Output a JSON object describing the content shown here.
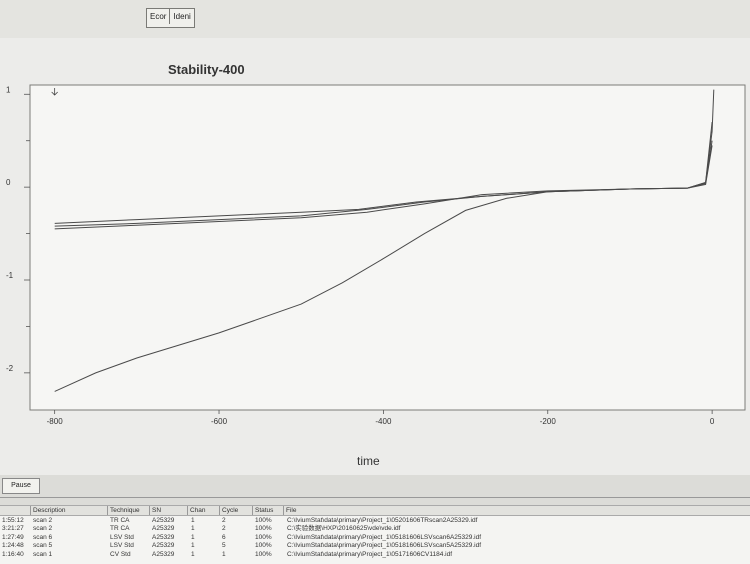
{
  "toolbar": {
    "buttons": [
      "Ecor",
      "Ideni"
    ]
  },
  "chart_data": {
    "type": "line",
    "title": "Stability-400",
    "xlabel": "time",
    "ylabel": "",
    "xlim": [
      -830,
      40
    ],
    "ylim": [
      -2.4,
      1.1
    ],
    "x_ticks": [
      "-800",
      "-600",
      "-400",
      "-200",
      "0"
    ],
    "y_ticks": [
      "1",
      "0",
      "-1",
      "-2"
    ],
    "grid": true,
    "series": [
      {
        "values": [
          [
            -800,
            -0.45
          ],
          [
            -700,
            -0.41
          ],
          [
            -600,
            -0.37
          ],
          [
            -500,
            -0.33
          ],
          [
            -420,
            -0.27
          ],
          [
            -350,
            -0.18
          ],
          [
            -280,
            -0.08
          ],
          [
            -200,
            -0.04
          ],
          [
            -100,
            -0.02
          ],
          [
            -30,
            -0.01
          ],
          [
            -8,
            0.05
          ],
          [
            0,
            0.6
          ],
          [
            2,
            1.05
          ]
        ]
      },
      {
        "values": [
          [
            -800,
            -0.39
          ],
          [
            -700,
            -0.35
          ],
          [
            -600,
            -0.31
          ],
          [
            -500,
            -0.27
          ],
          [
            -430,
            -0.24
          ],
          [
            -360,
            -0.16
          ],
          [
            -280,
            -0.1
          ],
          [
            -200,
            -0.05
          ],
          [
            -100,
            -0.02
          ],
          [
            -30,
            -0.01
          ],
          [
            -8,
            0.03
          ],
          [
            0,
            0.45
          ]
        ]
      },
      {
        "values": [
          [
            -800,
            -0.42
          ],
          [
            -700,
            -0.39
          ],
          [
            -600,
            -0.35
          ],
          [
            -500,
            -0.31
          ],
          [
            -420,
            -0.24
          ],
          [
            -350,
            -0.16
          ],
          [
            -280,
            -0.1
          ],
          [
            -200,
            -0.05
          ],
          [
            -100,
            -0.02
          ],
          [
            -30,
            -0.01
          ],
          [
            -8,
            0.04
          ],
          [
            0,
            0.5
          ]
        ]
      },
      {
        "values": [
          [
            -800,
            -2.2
          ],
          [
            -750,
            -2.0
          ],
          [
            -700,
            -1.84
          ],
          [
            -600,
            -1.57
          ],
          [
            -500,
            -1.26
          ],
          [
            -450,
            -1.03
          ],
          [
            -400,
            -0.77
          ],
          [
            -350,
            -0.5
          ],
          [
            -300,
            -0.25
          ],
          [
            -250,
            -0.12
          ],
          [
            -200,
            -0.05
          ],
          [
            -100,
            -0.02
          ],
          [
            -30,
            -0.01
          ],
          [
            -8,
            0.05
          ],
          [
            0,
            0.7
          ]
        ]
      }
    ]
  },
  "pause_label": "Pause",
  "table": {
    "headers": [
      "Description",
      "Technique",
      "SN",
      "Chan",
      "Cycle",
      "Status",
      "File"
    ],
    "rows": [
      [
        "1:55:12",
        "scan 2",
        "TR CA",
        "A25329",
        "1",
        "2",
        "100%",
        "C:\\IviumStat\\data\\primary\\Project_1\\05201606TRscan2A25329.idf"
      ],
      [
        "3:21:27",
        "scan 2",
        "TR CA",
        "A25329",
        "1",
        "2",
        "100%",
        "C:\\实验数据\\HXP\\20160625\\vde\\vde.idf"
      ],
      [
        "1:27:49",
        "scan 6",
        "LSV Std",
        "A25329",
        "1",
        "6",
        "100%",
        "C:\\IviumStat\\data\\primary\\Project_1\\05181606LSVscan6A25329.idf"
      ],
      [
        "1:24:48",
        "scan 5",
        "LSV Std",
        "A25329",
        "1",
        "5",
        "100%",
        "C:\\IviumStat\\data\\primary\\Project_1\\05181606LSVscan5A25329.idf"
      ],
      [
        "1:16:40",
        "scan 1",
        "CV Std",
        "A25329",
        "1",
        "1",
        "100%",
        "C:\\IviumStat\\data\\primary\\Project_1\\05171606CV1184.idf"
      ]
    ]
  }
}
